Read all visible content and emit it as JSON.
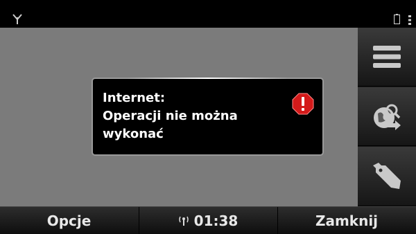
{
  "status_bar": {
    "signal_icon": "antenna-icon",
    "battery_icon": "battery-icon",
    "menu_icon": "vertical-dots-icon"
  },
  "toolbar": {
    "items": [
      {
        "icon": "menu-lines-icon"
      },
      {
        "icon": "globe-search-icon"
      },
      {
        "icon": "bookmark-tag-icon"
      }
    ]
  },
  "dialog": {
    "lines": [
      "Internet:",
      "Operacji nie można",
      "wykonać"
    ],
    "icon": "warning-icon",
    "icon_color": "#d41a1a"
  },
  "softkeys": {
    "left": "Opcje",
    "clock": "01:38",
    "right": "Zamknij"
  },
  "colors": {
    "content_bg": "#7b7b7b",
    "dialog_bg": "#000000"
  }
}
